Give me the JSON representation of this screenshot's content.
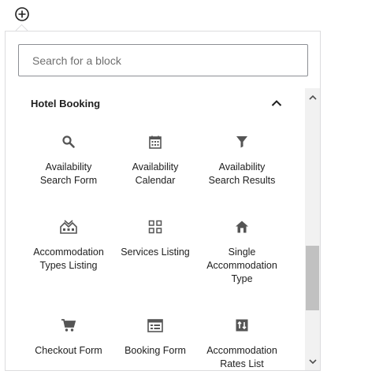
{
  "inserter": {
    "toggle_icon": "plus-circle-icon"
  },
  "search": {
    "placeholder": "Search for a block",
    "value": ""
  },
  "panel": {
    "title": "Hotel Booking",
    "collapse_icon": "chevron-up-icon",
    "blocks": [
      {
        "label": "Availability\nSearch Form",
        "icon": "search-icon"
      },
      {
        "label": "Availability\nCalendar",
        "icon": "calendar-icon"
      },
      {
        "label": "Availability\nSearch Results",
        "icon": "filter-icon"
      },
      {
        "label": "Accommodation\nTypes Listing",
        "icon": "buildings-icon"
      },
      {
        "label": "Services Listing",
        "icon": "grid-icon"
      },
      {
        "label": "Single\nAccommodation\nType",
        "icon": "home-icon"
      },
      {
        "label": "Checkout Form",
        "icon": "cart-icon"
      },
      {
        "label": "Booking Form",
        "icon": "form-icon"
      },
      {
        "label": "Accommodation\nRates List",
        "icon": "sort-icon"
      }
    ]
  },
  "scrollbar": {
    "position_fraction": 0.58
  },
  "colors": {
    "border": "#dcdcde",
    "text": "#1e1e1e",
    "icon": "#555555",
    "input_border": "#8c8f94"
  }
}
